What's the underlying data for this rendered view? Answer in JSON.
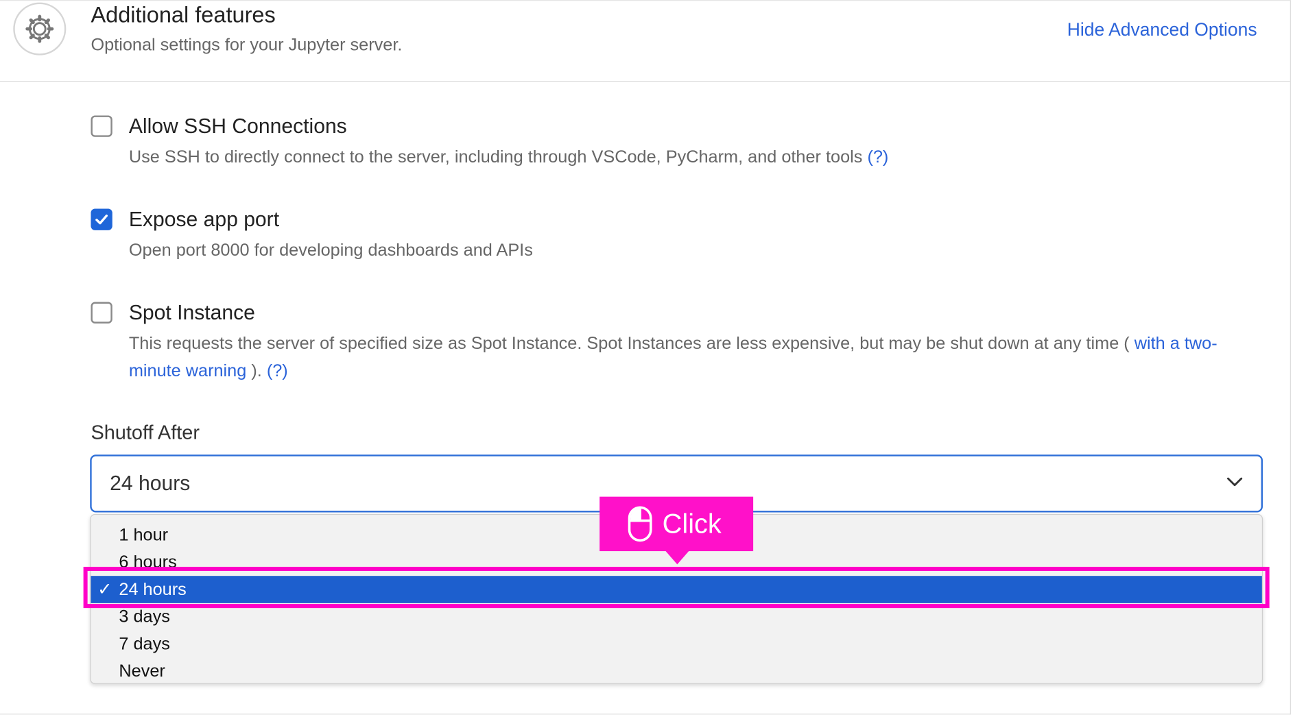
{
  "header": {
    "title": "Additional features",
    "subtitle": "Optional settings for your Jupyter server.",
    "toggle_link": "Hide Advanced Options"
  },
  "options": {
    "ssh": {
      "label": "Allow SSH Connections",
      "checked": false,
      "description": "Use SSH to directly connect to the server, including through VSCode, PyCharm, and other tools",
      "help": "(?)"
    },
    "app_port": {
      "label": "Expose app port",
      "checked": true,
      "description": "Open port 8000 for developing dashboards and APIs"
    },
    "spot": {
      "label": "Spot Instance",
      "checked": false,
      "description": "This requests the server of specified size as Spot Instance. Spot Instances are less expensive, but may be shut down at any time (",
      "link": "with a two-minute warning",
      "after": ").",
      "help": "(?)"
    }
  },
  "shutoff": {
    "label": "Shutoff After",
    "selected": "24 hours",
    "options": [
      "1 hour",
      "6 hours",
      "24 hours",
      "3 days",
      "7 days",
      "Never"
    ],
    "check_glyph": "✓"
  },
  "annotation": {
    "label": "Click",
    "color": "#ff11c9"
  },
  "colors": {
    "accent": "#1f66d9",
    "link": "#2b63d9",
    "selected_row": "#1d5fce",
    "highlight": "#ff00c8"
  }
}
